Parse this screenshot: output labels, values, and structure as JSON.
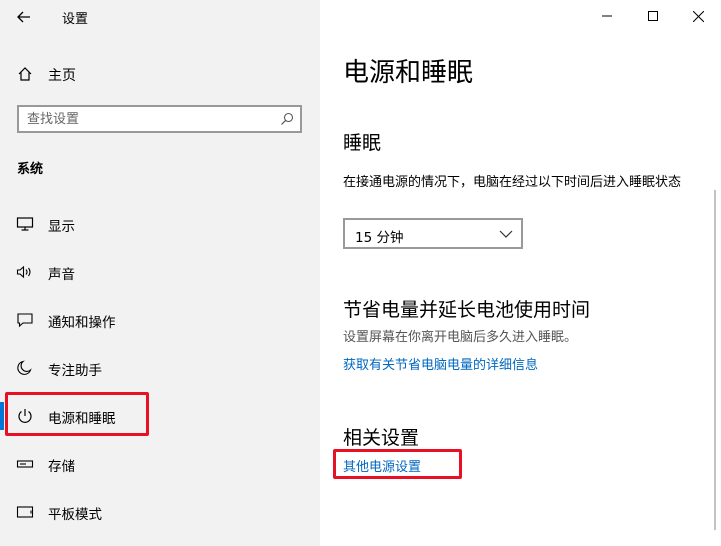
{
  "window": {
    "title": "设置",
    "minimize_glyph": "—",
    "maximize_glyph": "☐",
    "close_glyph": "✕"
  },
  "sidebar": {
    "home_label": "主页",
    "search_placeholder": "查找设置",
    "section_label": "系统",
    "items": [
      {
        "label": "显示",
        "icon": "monitor-icon"
      },
      {
        "label": "声音",
        "icon": "speaker-icon"
      },
      {
        "label": "通知和操作",
        "icon": "message-icon"
      },
      {
        "label": "专注助手",
        "icon": "moon-icon"
      },
      {
        "label": "电源和睡眠",
        "icon": "power-icon",
        "active": true
      },
      {
        "label": "存储",
        "icon": "storage-icon"
      },
      {
        "label": "平板模式",
        "icon": "tablet-icon"
      }
    ]
  },
  "main": {
    "title": "电源和睡眠",
    "sleep": {
      "heading": "睡眠",
      "description": "在接通电源的情况下，电脑在经过以下时间后进入睡眠状态",
      "dropdown_value": "15 分钟"
    },
    "battery": {
      "heading": "节省电量并延长电池使用时间",
      "description": "设置屏幕在你离开电脑后多久进入睡眠。",
      "link": "获取有关节省电脑电量的详细信息"
    },
    "related": {
      "heading": "相关设置",
      "link": "其他电源设置"
    }
  },
  "colors": {
    "accent": "#0078d7",
    "link": "#0067c0",
    "highlight": "#e81123",
    "sidebar_bg": "#f2f2f2"
  }
}
